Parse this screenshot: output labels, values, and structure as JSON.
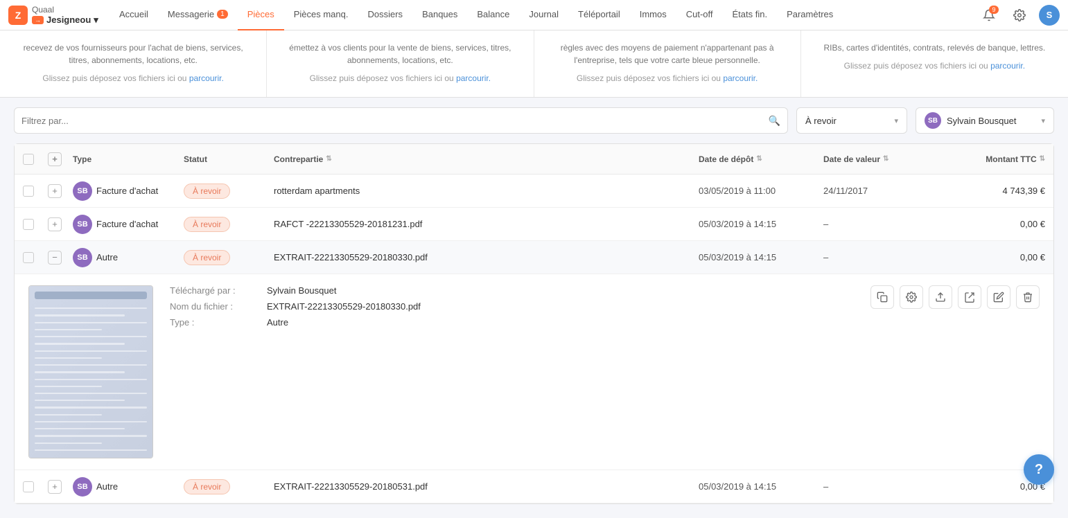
{
  "nav": {
    "logo_letter": "Z",
    "company": "Quaal",
    "user": "Jesigneou",
    "user_badge": "▼",
    "items": [
      {
        "label": "Accueil",
        "active": false
      },
      {
        "label": "Messagerie",
        "active": false,
        "badge": "1"
      },
      {
        "label": "Pièces",
        "active": true
      },
      {
        "label": "Pièces manq.",
        "active": false
      },
      {
        "label": "Dossiers",
        "active": false
      },
      {
        "label": "Banques",
        "active": false
      },
      {
        "label": "Balance",
        "active": false
      },
      {
        "label": "Journal",
        "active": false
      },
      {
        "label": "Téléportail",
        "active": false
      },
      {
        "label": "Immos",
        "active": false
      },
      {
        "label": "Cut-off",
        "active": false
      },
      {
        "label": "États fin.",
        "active": false
      },
      {
        "label": "Paramètres",
        "active": false
      }
    ],
    "notif_count": "9",
    "user_initial": "S"
  },
  "upload_cards": [
    {
      "desc_plain": "recevez de vos fournisseurs pour l'achat de biens, services, titres, abonnements, locations, etc.",
      "drop_text": "Glissez puis déposez vos fichiers ici ou ",
      "drop_link": "parcourir."
    },
    {
      "desc_plain": "émettez à vos clients pour la vente de biens, services, titres, abonnements, locations, etc.",
      "drop_text": "Glissez puis déposez vos fichiers ici ou ",
      "drop_link": "parcourir."
    },
    {
      "desc_plain": "règles avec des moyens de paiement n'appartenant pas à l'entreprise, tels que votre carte bleue personnelle.",
      "drop_text": "Glissez puis déposez vos fichiers ici ou ",
      "drop_link": "parcourir."
    },
    {
      "desc_plain": "RIBs, cartes d'identités, contrats, relevés de banque, lettres.",
      "drop_text": "Glissez puis déposez vos fichiers ici ou ",
      "drop_link": "parcourir."
    }
  ],
  "filter": {
    "placeholder": "Filtrez par...",
    "status_value": "À revoir",
    "user_name": "Sylvain Bousquet",
    "user_initials": "SB"
  },
  "table": {
    "columns": [
      "Type",
      "Statut",
      "Contrepartie",
      "Date de dépôt",
      "Date de valeur",
      "Montant TTC"
    ],
    "rows": [
      {
        "type": "Facture d'achat",
        "status": "À revoir",
        "contrepartie": "rotterdam apartments",
        "date_depot": "03/05/2019 à 11:00",
        "date_valeur": "24/11/2017",
        "montant": "4 743,39 €",
        "expanded": false
      },
      {
        "type": "Facture d'achat",
        "status": "À revoir",
        "contrepartie": "RAFCT -22213305529-20181231.pdf",
        "date_depot": "05/03/2019 à 14:15",
        "date_valeur": "–",
        "montant": "0,00 €",
        "expanded": false
      },
      {
        "type": "Autre",
        "status": "À revoir",
        "contrepartie": "EXTRAIT-22213305529-20180330.pdf",
        "date_depot": "05/03/2019 à 14:15",
        "date_valeur": "–",
        "montant": "0,00 €",
        "expanded": true
      }
    ],
    "expanded_row": {
      "uploaded_by_label": "Téléchargé par :",
      "uploaded_by_value": "Sylvain Bousquet",
      "filename_label": "Nom du fichier :",
      "filename_value": "EXTRAIT-22213305529-20180330.pdf",
      "type_label": "Type :",
      "type_value": "Autre"
    },
    "row4": {
      "type": "Autre",
      "status": "À revoir",
      "contrepartie": "EXTRAIT-22213305529-20180531.pdf",
      "date_depot": "05/03/2019 à 14:15",
      "date_valeur": "–",
      "montant": "0,00 €"
    }
  },
  "help_button": "?",
  "actions": {
    "copy": "⊞",
    "settings": "⚙",
    "export": "↑",
    "redirect": "↗",
    "edit": "✎",
    "delete": "🗑"
  }
}
